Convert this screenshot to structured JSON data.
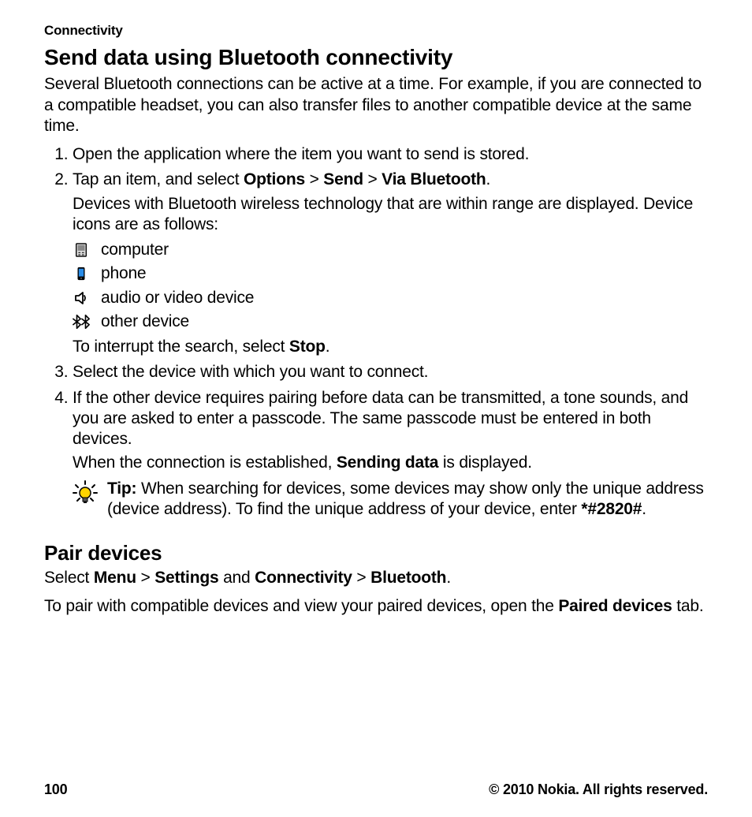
{
  "header": {
    "section": "Connectivity"
  },
  "section1": {
    "title": "Send data using Bluetooth connectivity",
    "intro": "Several Bluetooth connections can be active at a time. For example, if you are connected to a compatible headset, you can also transfer files to another compatible device at the same time."
  },
  "steps": {
    "s1": "Open the application where the item you want to send is stored.",
    "s2": {
      "lead": "Tap an item, and select ",
      "b1": "Options",
      "sep": " > ",
      "b2": "Send",
      "b3": "Via Bluetooth",
      "tail": ".",
      "after": "Devices with Bluetooth wireless technology that are within range are displayed. Device icons are as follows:",
      "icons": {
        "computer": "computer",
        "phone": "phone",
        "audio": "audio or video device",
        "other": "other device"
      },
      "interrupt_pre": "To interrupt the search, select ",
      "interrupt_bold": "Stop",
      "interrupt_post": "."
    },
    "s3": "Select the device with which you want to connect.",
    "s4": {
      "text": "If the other device requires pairing before data can be transmitted, a tone sounds, and you are asked to enter a passcode. The same passcode must be entered in both devices.",
      "after_pre": "When the connection is established, ",
      "after_bold": "Sending data",
      "after_post": " is displayed."
    }
  },
  "tip": {
    "label": "Tip:",
    "text": " When searching for devices, some devices may show only the unique address (device address). To find the unique address of your device, enter ",
    "code": "*#2820#",
    "post": "."
  },
  "section2": {
    "title": "Pair devices",
    "nav_pre": "Select ",
    "nav_b1": "Menu",
    "nav_sep": " > ",
    "nav_b2": "Settings",
    "nav_mid": " and ",
    "nav_b3": "Connectivity",
    "nav_b4": "Bluetooth",
    "nav_post": ".",
    "para_pre": "To pair with compatible devices and view your paired devices, open the ",
    "para_bold": "Paired devices",
    "para_post": " tab."
  },
  "footer": {
    "page": "100",
    "copyright": "© 2010 Nokia. All rights reserved."
  }
}
